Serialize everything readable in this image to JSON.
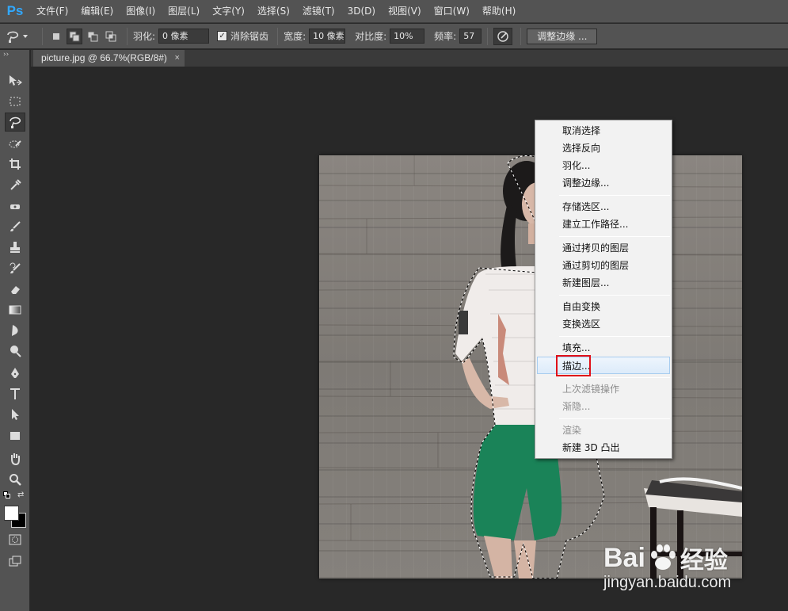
{
  "app": {
    "logo": "Ps"
  },
  "menubar": {
    "items": [
      "文件(F)",
      "编辑(E)",
      "图像(I)",
      "图层(L)",
      "文字(Y)",
      "选择(S)",
      "滤镜(T)",
      "3D(D)",
      "视图(V)",
      "窗口(W)",
      "帮助(H)"
    ]
  },
  "options": {
    "feather_label": "羽化:",
    "feather_value": "0 像素",
    "antialias_label": "消除锯齿",
    "width_label": "宽度:",
    "width_value": "10 像素",
    "contrast_label": "对比度:",
    "contrast_value": "10%",
    "frequency_label": "频率:",
    "frequency_value": "57",
    "refine_edge_label": "调整边缘 ..."
  },
  "document": {
    "tab_title": "picture.jpg @ 66.7%(RGB/8#)",
    "close_glyph": "×"
  },
  "context_menu": {
    "items": [
      {
        "label": "取消选择",
        "disabled": false
      },
      {
        "label": "选择反向",
        "disabled": false
      },
      {
        "label": "羽化...",
        "disabled": false
      },
      {
        "label": "调整边缘...",
        "disabled": false
      },
      {
        "label": "存储选区...",
        "disabled": false
      },
      {
        "label": "建立工作路径...",
        "disabled": false
      },
      {
        "label": "通过拷贝的图层",
        "disabled": false
      },
      {
        "label": "通过剪切的图层",
        "disabled": false
      },
      {
        "label": "新建图层...",
        "disabled": false
      },
      {
        "label": "自由变换",
        "disabled": false
      },
      {
        "label": "变换选区",
        "disabled": false
      },
      {
        "label": "填充...",
        "disabled": false
      },
      {
        "label": "描边...",
        "disabled": false,
        "hovered": true
      },
      {
        "label": "上次滤镜操作",
        "disabled": true
      },
      {
        "label": "渐隐...",
        "disabled": true
      },
      {
        "label": "渲染",
        "disabled": true
      },
      {
        "label": "新建 3D 凸出",
        "disabled": false
      }
    ]
  },
  "watermark": {
    "brand": "Bai",
    "brand_suffix": "经验",
    "url": "jingyan.baidu.com"
  },
  "colors": {
    "accent_highlight": "#e0101a",
    "ps_blue": "#31a8ff",
    "foreground_swatch": "#ffffff",
    "background_swatch": "#000000"
  }
}
